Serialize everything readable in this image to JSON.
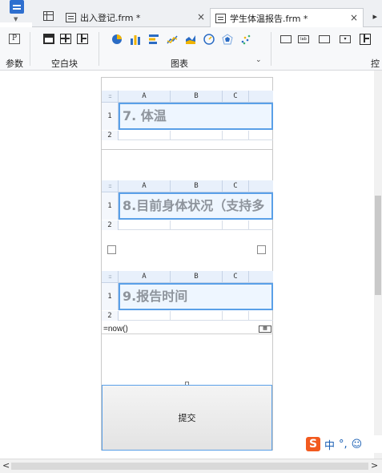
{
  "tabs": [
    {
      "label": "出入登记.frm *",
      "close": "×"
    },
    {
      "label": "学生体温报告.frm *",
      "close": "×"
    }
  ],
  "ribbon": {
    "groups": [
      {
        "label": "参数"
      },
      {
        "label": "空白块"
      },
      {
        "label": "图表"
      },
      {
        "label": "控"
      }
    ],
    "param_icon_text": "P",
    "dropdown_caret": "⌄"
  },
  "sheets": [
    {
      "title": "7. 体温",
      "columns": [
        "A",
        "B",
        "C"
      ],
      "rows": [
        "1",
        "2"
      ]
    },
    {
      "title": "8.目前身体状况（支持多",
      "columns": [
        "A",
        "B",
        "C"
      ],
      "rows": [
        "1",
        "2"
      ]
    },
    {
      "title": "9.报告时间",
      "columns": [
        "A",
        "B",
        "C"
      ],
      "rows": [
        "1",
        "2"
      ]
    }
  ],
  "sheet_corner": ":::",
  "formula": {
    "value": "=now()"
  },
  "submit_button": {
    "label": "提交"
  },
  "ime": {
    "logo": "S",
    "lang": "中",
    "punct": "°,",
    "emoji": "☺"
  },
  "scroll": {
    "left": "<",
    "right": ">"
  },
  "colors": {
    "accent": "#5aa0e8",
    "header_bg": "#e8f0fb",
    "ime_brand": "#f25a1f"
  }
}
